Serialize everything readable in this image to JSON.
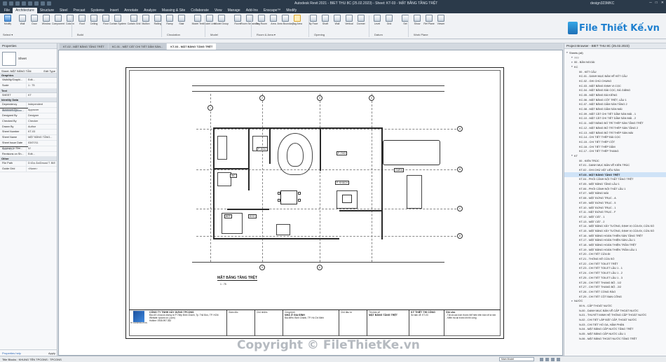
{
  "titlebar": {
    "title": "Autodesk Revit 2021 - BIET THU 8C (25.02.2023) - Sheet: KT-03 - MẶT BẰNG TẦNG TRỆT",
    "user": "design323MKC"
  },
  "menu": [
    "File",
    "Architecture",
    "Structure",
    "Steel",
    "Precast",
    "Systems",
    "Insert",
    "Annotate",
    "Analyze",
    "Massing & Site",
    "Collaborate",
    "View",
    "Manage",
    "Add-Ins",
    "Enscape™",
    "Modify"
  ],
  "ribbon": {
    "buttons": [
      "Modify",
      "Wall",
      "Door",
      "Window",
      "Component",
      "Column",
      "Roof",
      "Ceiling",
      "Floor",
      "Curtain System",
      "Curtain Grid",
      "Mullion",
      "Railing",
      "Ramp",
      "Stair",
      "Model Text",
      "Model Line",
      "Model Group",
      "Room",
      "Room Separator",
      "Tag Room",
      "Area",
      "Area Boundary",
      "Tag Area",
      "By Face",
      "Shaft",
      "Wall",
      "Vertical",
      "Dormer",
      "Level",
      "Grid",
      "Set",
      "Show",
      "Ref Plane",
      "Viewer"
    ],
    "groups": [
      "Select ▾",
      "Build",
      "Circulation",
      "Model",
      "Room & Area ▾",
      "Opening",
      "Datum",
      "Work Plane"
    ]
  },
  "brand": {
    "text": "File Thiết Kế.vn"
  },
  "properties": {
    "header": "Properties",
    "type_name": "Sheet",
    "type_row": {
      "label": "Sheet: MẶT BẰNG TẦN",
      "edit": "Edit Type"
    },
    "sections": [
      {
        "title": "Graphics",
        "rows": [
          {
            "k": "Visibility/Graphi...",
            "v": "Edit..."
          },
          {
            "k": "Scale",
            "v": "1 : 75"
          }
        ]
      },
      {
        "title": "Text",
        "rows": [
          {
            "k": "SHEET",
            "v": "KT"
          }
        ]
      },
      {
        "title": "Identity Data",
        "rows": [
          {
            "k": "Dependency",
            "v": "Independent"
          },
          {
            "k": "Referencing She...",
            "v": ""
          },
          {
            "k": "Referencing Det...",
            "v": ""
          },
          {
            "k": "Current Revision...",
            "v": ""
          },
          {
            "k": "Current Revision...",
            "v": ""
          },
          {
            "k": "Current Revision...",
            "v": ""
          },
          {
            "k": "Current Revision...",
            "v": ""
          },
          {
            "k": "Current Revision",
            "v": ""
          },
          {
            "k": "Approved By",
            "v": "Approver"
          },
          {
            "k": "Designed By",
            "v": "Designer"
          },
          {
            "k": "Checked By",
            "v": "Checker"
          },
          {
            "k": "Drawn By",
            "v": "Author"
          },
          {
            "k": "Sheet Number",
            "v": "KT-03"
          },
          {
            "k": "Sheet Name",
            "v": "MẶT BẰNG TẦNG..."
          },
          {
            "k": "Sheet Issue Date",
            "v": "03/07/11"
          },
          {
            "k": "View style",
            "v": ""
          },
          {
            "k": "Appears In She...",
            "v": "☑"
          },
          {
            "k": "Revisions on Sh...",
            "v": "Edit..."
          }
        ]
      },
      {
        "title": "Other",
        "rows": [
          {
            "k": "File Path",
            "v": "D:\\Dự Án\\Dmost T. BIE"
          },
          {
            "k": "Guide Grid",
            "v": "<None>"
          }
        ]
      }
    ],
    "help": "Properties help",
    "apply": "Apply"
  },
  "tabs": [
    "KT-02 - MẶT BẰNG TẦNG TRỆT",
    "KC-01 - MẶT CẮT CHI TIẾT DẦM SÀN...",
    "KT-03 - MẶT BẰNG TẦNG TRỆT"
  ],
  "drawing": {
    "title": "MẶT BẰNG TẦNG TRỆT",
    "scale": "1 : 75",
    "rooms": [
      "P. NGỦ",
      "WC",
      "P. THỜ",
      "P. KHÁCH",
      "BẾP",
      "KHO",
      "GARA"
    ],
    "grids": [
      "1",
      "2",
      "3",
      "4",
      "5",
      "6",
      "7",
      "A",
      "B",
      "C",
      "D",
      "E"
    ]
  },
  "titleblock": {
    "company": "CÔNG TY TNHH XÂY DỰNG TPCONS",
    "address": "Địa chỉ: chưa là chứng từ P. Hiệp Bình Chánh, Tp. Thủ Đức, TP. HCM",
    "web": "Website: tpcons.vn (.com)",
    "hotline": "Hotline: 0935.997.352",
    "logo_text": "TP CONSTRUCTION",
    "c1": "Giám đốc",
    "c2": "Chủ nhiệm",
    "c3": "Công trình",
    "c3v": "NHÀ Ở GIA ĐÌNH",
    "c3a": "Địa điểm: Bình Chánh, TP. Hồ Chí Minh",
    "c4": "Chủ đầu tư",
    "c5": "Tên bản vẽ",
    "c5v": "MẶT BẰNG TẦNG TRỆT",
    "c6": "KÝ THIỆT THI CÔNG",
    "c6s": "Số bản vẽ: KT-03",
    "notes_title": "Ghi chú",
    "notes": "- Tất cả các kích thước thể hiện trên bản vẽ là mm\n- Kiểm tra lại trước khi thi công"
  },
  "browser": {
    "header": "Project Browser - BIET THU 8C (25.02.2023)",
    "items": [
      {
        "t": "Sheets (all)",
        "l": 0
      },
      {
        "t": "???",
        "l": 1
      },
      {
        "t": "00 - BẢN NGOÀI",
        "l": 1
      },
      {
        "t": "KC",
        "l": 1
      },
      {
        "t": "00 - KẾT CẤU",
        "l": 2
      },
      {
        "t": "KC-01 - DANH MỤC BẢN VẼ KẾT CẤU",
        "l": 2
      },
      {
        "t": "KC-02 - GHI CHÚ CHUNG",
        "l": 2
      },
      {
        "t": "KC-03 - MẶT BẰNG ĐỊNH VỊ CỌC",
        "l": 2
      },
      {
        "t": "KC-04 - MẶT BẰNG ĐÀI CỌC, ĐÀ GIẰNG",
        "l": 2
      },
      {
        "t": "KC-05 - MẶT BẰNG ĐÀ KIỀNG",
        "l": 2
      },
      {
        "t": "KC-06 - MẶT BẰNG CỘT TRỆT, LẦU 1",
        "l": 2
      },
      {
        "t": "KC-07 - MẶT BẰNG DẦM SÀN TẦNG 2",
        "l": 2
      },
      {
        "t": "KC-08 - MẶT BẰNG DẦM SÀN MÁI",
        "l": 2
      },
      {
        "t": "KC-09 - MẶT CẮT CHI TIẾT DẦM SÀN MÁI - 1",
        "l": 2
      },
      {
        "t": "KC-10 - MẶT CẮT CHI TIẾT DẦM SÀN MÁI - 2",
        "l": 2
      },
      {
        "t": "KC-11 - MẶT BẰNG BỐ TRÍ THÉP SÀN TẦNG TRỆT",
        "l": 2
      },
      {
        "t": "KC-12 - MẶT BẰNG BỐ TRÍ THÉP SÀN TẦNG 2",
        "l": 2
      },
      {
        "t": "KC-13 - MẶT BẰNG BỐ TRÍ THÉP SÀN MÁI",
        "l": 2
      },
      {
        "t": "KC-14 - CHI TIẾT THÉP ĐÀI CỌC",
        "l": 2
      },
      {
        "t": "KC-15 - CHI TIẾT THÉP CỘT",
        "l": 2
      },
      {
        "t": "KC-16 - CHI TIẾT THÉP DẦM",
        "l": 2
      },
      {
        "t": "KC-17 - CHI TIẾT THÉP THANG",
        "l": 2
      },
      {
        "t": "KT",
        "l": 1
      },
      {
        "t": "00 - KIẾN TRÚC",
        "l": 2
      },
      {
        "t": "KT-01 - DANH MỤC BẢN VẼ KIẾN TRÚC",
        "l": 2
      },
      {
        "t": "KT-02 - GHI CHÚ VẬT LIỆU SÀN",
        "l": 2
      },
      {
        "t": "KT-03 - MẶT BẰNG TẦNG TRỆT",
        "l": 2,
        "sel": true
      },
      {
        "t": "KT-04 - PHỐI CẢNH NỘI THẤT TẦNG TRỆT",
        "l": 2
      },
      {
        "t": "KT-05 - MẶT BẰNG TẦNG LẦU 1",
        "l": 2
      },
      {
        "t": "KT-06 - PHỐI CẢNH NỘI THẤT LẦU 1",
        "l": 2
      },
      {
        "t": "KT-07 - MẶT BẰNG MÁI",
        "l": 2
      },
      {
        "t": "KT-08 - MẶT ĐỨNG TRỤC - A",
        "l": 2
      },
      {
        "t": "KT-09 - MẶT ĐỨNG TRỤC - 5",
        "l": 2
      },
      {
        "t": "KT-10 - MẶT ĐỨNG TRỤC - 1",
        "l": 2
      },
      {
        "t": "KT-11 - MẶT ĐỨNG TRỤC - F",
        "l": 2
      },
      {
        "t": "KT-12 - MẶT CẮT - 1",
        "l": 2
      },
      {
        "t": "KT-13 - MẶT CẮT - 2",
        "l": 2
      },
      {
        "t": "KT-14 - MẶT BẰNG XÂY TƯỜNG, ĐỊNH VỊ CỬA ĐI, CỬA SỔ",
        "l": 2
      },
      {
        "t": "KT-15 - MẶT BẰNG XÂY TƯỜNG, ĐỊNH VỊ CỬA ĐI, CỬA SỔ",
        "l": 2
      },
      {
        "t": "KT-16 - MẶT BẰNG HOÀN THIỆN SÀN TẦNG TRỆT",
        "l": 2
      },
      {
        "t": "KT-17 - MẶT BẰNG HOÀN THIỆN SÀN LẦU 1",
        "l": 2
      },
      {
        "t": "KT-18 - MẶT BẰNG HOÀN THIỆN TRẦN TRỆT",
        "l": 2
      },
      {
        "t": "KT-19 - MẶT BẰNG HOÀN THIỆN TRẦN LẦU 1",
        "l": 2
      },
      {
        "t": "KT-20 - CHI TIẾT CỬA ĐI",
        "l": 2
      },
      {
        "t": "KT-21 - THỐNG KÊ CỬA SỔ",
        "l": 2
      },
      {
        "t": "KT-22 - CHI TIẾT TOILET TRỆT",
        "l": 2
      },
      {
        "t": "KT-23 - CHI TIẾT TOILET LẦU 1 - 1",
        "l": 2
      },
      {
        "t": "KT-24 - CHI TIẾT TOILET LẦU 1 - 2",
        "l": 2
      },
      {
        "t": "KT-25 - CHI TIẾT TOILET LẦU 1 - 3",
        "l": 2
      },
      {
        "t": "KT-26 - CHI TIẾT THANG BỘ - 1/2",
        "l": 2
      },
      {
        "t": "KT-27 - CHI TIẾT THANG BỘ - 2/2",
        "l": 2
      },
      {
        "t": "KT-28 - CHI TIẾT CỔNG RÀO",
        "l": 2
      },
      {
        "t": "KT-29 - CHI TIẾT CỘT BAN CÔNG",
        "l": 2
      },
      {
        "t": "NƯỚC",
        "l": 1
      },
      {
        "t": "00 N - CẤP THOÁT NƯỚC",
        "l": 2
      },
      {
        "t": "N-00 - DANH MỤC BẢN VẼ CẤP THOÁT NƯỚC",
        "l": 2
      },
      {
        "t": "N-01 - THUYẾT MINH HỆ THỐNG CẤP THOÁT NƯỚC",
        "l": 2
      },
      {
        "t": "N-02 - CHI TIẾT LẮP ĐẶT CẤP, THOÁT NƯỚC",
        "l": 2
      },
      {
        "t": "N-03 - CHI TIẾT HỐ GA, HẦM PHÂN",
        "l": 2
      },
      {
        "t": "N-04 - MẶT BẰNG CẤP NƯỚC TẦNG TRỆT",
        "l": 2
      },
      {
        "t": "N-05 - MẶT BẰNG CẤP NƯỚC LẦU 1",
        "l": 2
      },
      {
        "t": "N-06 - MẶT BẰNG THOÁT NƯỚC TẦNG TRỆT",
        "l": 2
      }
    ]
  },
  "status": {
    "text": "Title Blocks : KHUNG TÊN TPCONS : TPCONS",
    "model": "Main Model"
  },
  "watermark": "Copyright © FileThietKe.vn"
}
